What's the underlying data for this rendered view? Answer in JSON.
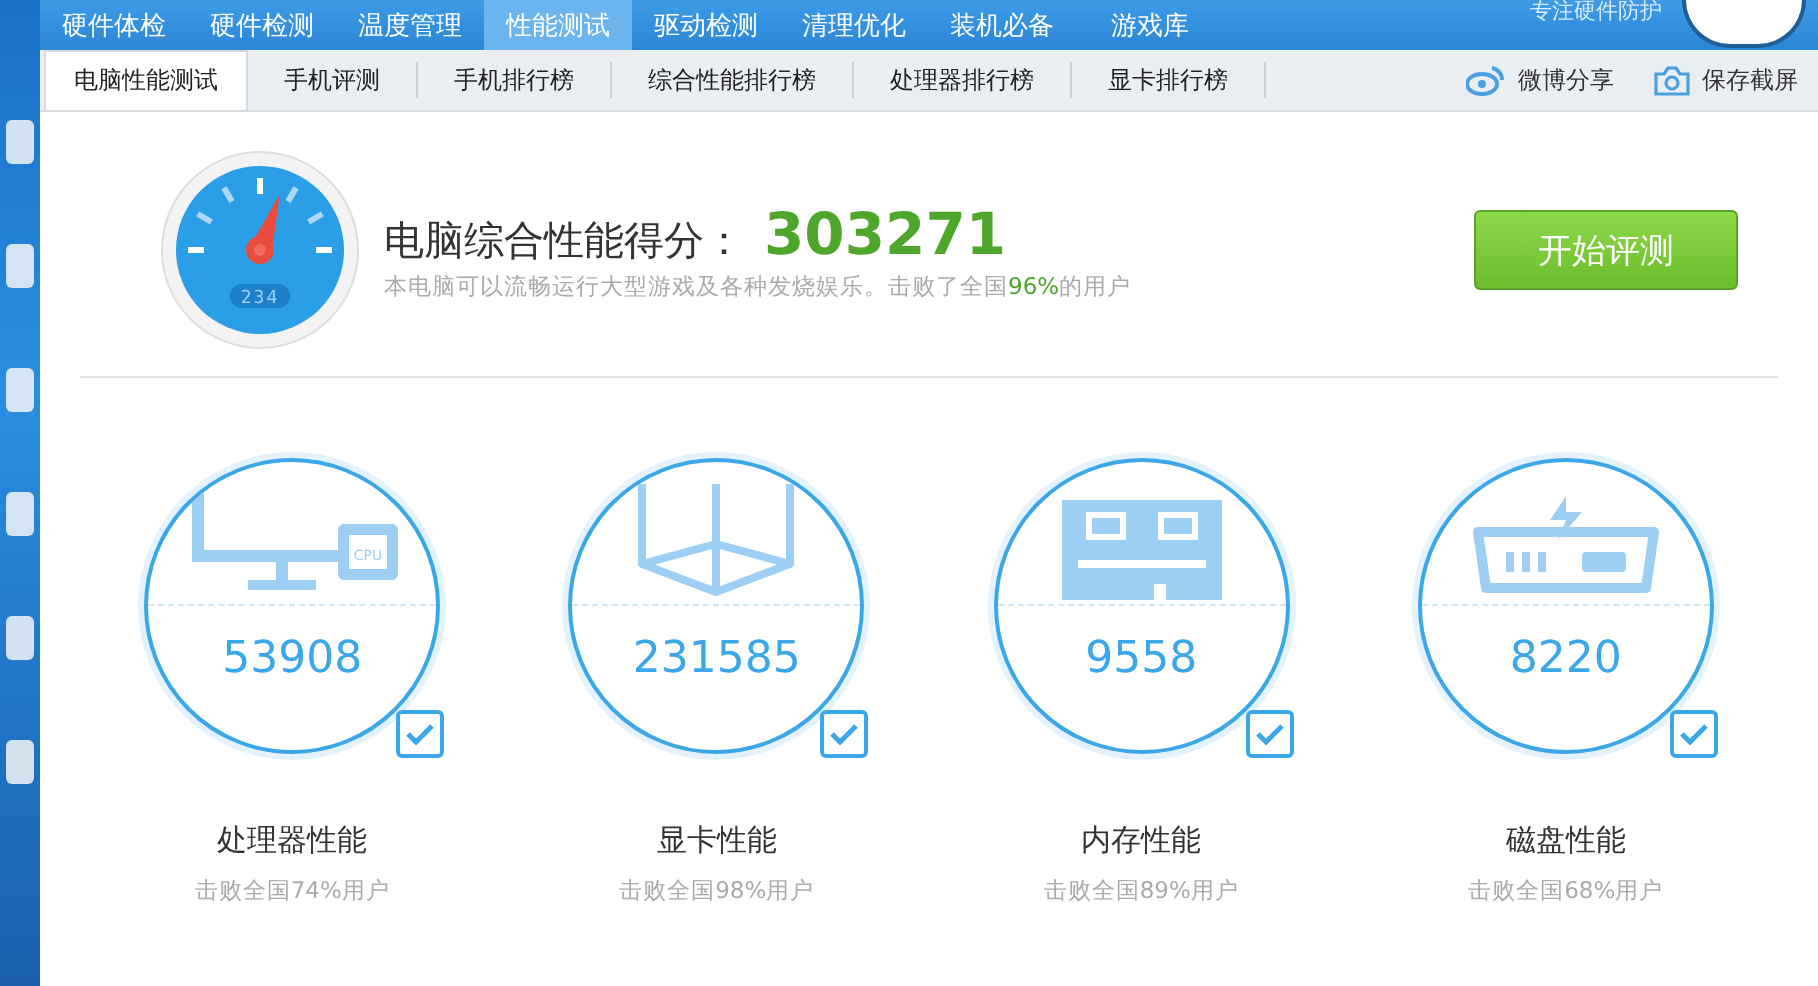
{
  "top_nav": {
    "tabs": [
      {
        "label": "硬件体检",
        "selected": false
      },
      {
        "label": "硬件检测",
        "selected": false
      },
      {
        "label": "温度管理",
        "selected": false
      },
      {
        "label": "性能测试",
        "selected": true
      },
      {
        "label": "驱动检测",
        "selected": false
      },
      {
        "label": "清理优化",
        "selected": false
      },
      {
        "label": "装机必备",
        "selected": false
      },
      {
        "label": "游戏库",
        "selected": false
      }
    ],
    "slogan": "专注硬件防护"
  },
  "sub_tabs": {
    "tabs": [
      {
        "label": "电脑性能测试",
        "selected": true
      },
      {
        "label": "手机评测",
        "selected": false
      },
      {
        "label": "手机排行榜",
        "selected": false
      },
      {
        "label": "综合性能排行榜",
        "selected": false
      },
      {
        "label": "处理器排行榜",
        "selected": false
      },
      {
        "label": "显卡排行榜",
        "selected": false
      }
    ],
    "actions": [
      {
        "kind": "weibo",
        "label": "微博分享"
      },
      {
        "kind": "camera",
        "label": "保存截屏"
      }
    ]
  },
  "summary": {
    "gauge_reading": "234",
    "title": "电脑综合性能得分：",
    "score": "303271",
    "subtitle": {
      "before": "本电脑可以流畅运行大型游戏及各种发烧娱乐。击败了全国",
      "highlight": "96%",
      "after": "的用户"
    },
    "button": "开始评测"
  },
  "components": [
    {
      "kind": "cpu",
      "chip_label": "CPU",
      "score": "53908",
      "checked": true,
      "name": "处理器性能",
      "beaten": "击败全国74%用户"
    },
    {
      "kind": "gpu",
      "score": "231585",
      "checked": true,
      "name": "显卡性能",
      "beaten": "击败全国98%用户"
    },
    {
      "kind": "memory",
      "score": "9558",
      "checked": true,
      "name": "内存性能",
      "beaten": "击败全国89%用户"
    },
    {
      "kind": "disk",
      "score": "8220",
      "checked": true,
      "name": "磁盘性能",
      "beaten": "击败全国68%用户"
    }
  ]
}
